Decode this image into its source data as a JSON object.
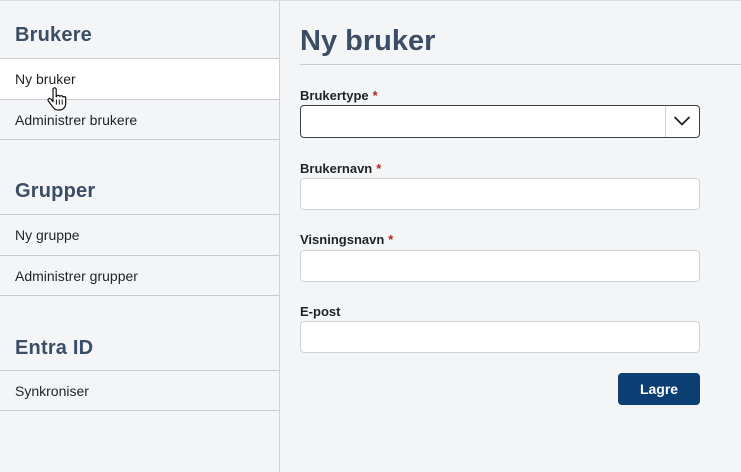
{
  "sidebar": {
    "sections": [
      {
        "title": "Brukere",
        "items": [
          "Ny bruker",
          "Administrer brukere"
        ]
      },
      {
        "title": "Grupper",
        "items": [
          "Ny gruppe",
          "Administrer grupper"
        ]
      },
      {
        "title": "Entra ID",
        "items": [
          "Synkroniser"
        ]
      }
    ],
    "active_item": "Ny bruker"
  },
  "main": {
    "title": "Ny bruker",
    "fields": [
      {
        "label": "Brukertype",
        "required_mark": "*",
        "type": "select",
        "value": ""
      },
      {
        "label": "Brukernavn",
        "required_mark": "*",
        "type": "text",
        "value": ""
      },
      {
        "label": "Visningsnavn",
        "required_mark": "*",
        "type": "text",
        "value": ""
      },
      {
        "label": "E-post",
        "required_mark": "",
        "type": "text",
        "value": ""
      }
    ],
    "save_label": "Lagre"
  },
  "colors": {
    "heading": "#3c4d66",
    "primary_button": "#0b3f73",
    "required": "#b3261e",
    "active_background": "#ffffff"
  },
  "icons": {
    "select": "chevron-down-icon",
    "pointer": "hand-pointer-icon"
  }
}
